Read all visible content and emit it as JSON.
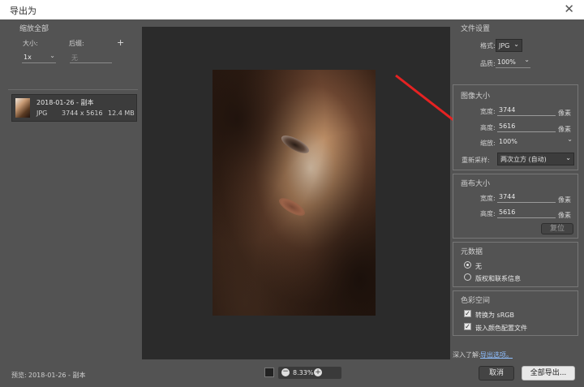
{
  "window": {
    "title": "导出为",
    "close_glyph": "✕"
  },
  "left": {
    "section_title": "缩放全部",
    "size_label": "大小:",
    "suffix_label": "后缀:",
    "add_glyph": "+",
    "size_value": "1x",
    "suffix_placeholder": "无",
    "item": {
      "name": "2018-01-26 - 副本",
      "format": "JPG",
      "dimensions": "3744 x 5616",
      "filesize": "12.4 MB"
    }
  },
  "bottom": {
    "preview_label": "预览:",
    "preview_name": "2018-01-26 - 副本",
    "zoom": "8.33%",
    "learn_more": "深入了解:",
    "export_options_link": "导出选项。",
    "cancel": "取消",
    "export_all": "全部导出..."
  },
  "file_settings": {
    "title": "文件设置",
    "format_label": "格式:",
    "format_value": "JPG",
    "quality_label": "品质:",
    "quality_value": "100%"
  },
  "image_size": {
    "title": "图像大小",
    "width_label": "宽度:",
    "width_value": "3744",
    "height_label": "高度:",
    "height_value": "5616",
    "scale_label": "缩放:",
    "scale_value": "100%",
    "unit": "像素",
    "resample_label": "重新采样:",
    "resample_value": "两次立方 (自动)"
  },
  "canvas_size": {
    "title": "画布大小",
    "width_label": "宽度:",
    "width_value": "3744",
    "height_label": "高度:",
    "height_value": "5616",
    "unit": "像素",
    "reset": "复位"
  },
  "metadata": {
    "title": "元数据",
    "option_none": "无",
    "option_copyright": "版权和联系信息"
  },
  "color_space": {
    "title": "色彩空间",
    "convert_srgb": "转换为 sRGB",
    "embed_profile": "嵌入颜色配置文件"
  },
  "annotation": {
    "color": "#e52222"
  }
}
